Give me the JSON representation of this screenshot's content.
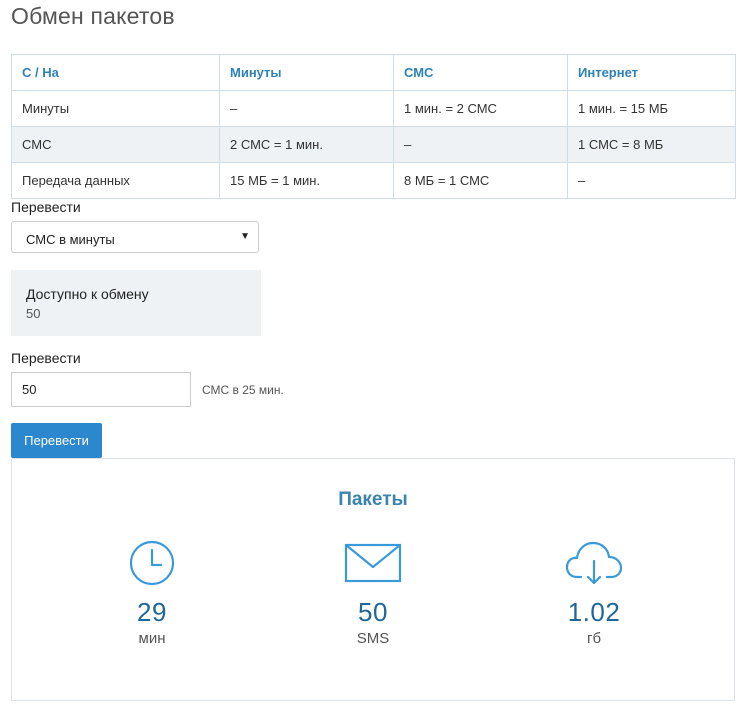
{
  "page": {
    "title": "Обмен пакетов"
  },
  "table": {
    "headers": [
      "С / На",
      "Минуты",
      "СМС",
      "Интернет"
    ],
    "rows": [
      [
        "Минуты",
        "–",
        "1 мин. = 2 СМС",
        "1 мин. = 15 МБ"
      ],
      [
        "СМС",
        "2 СМС = 1 мин.",
        "–",
        "1 СМС = 8 МБ"
      ],
      [
        "Передача данных",
        "15 МБ = 1 мин.",
        "8 МБ = 1 СМС",
        "–"
      ]
    ]
  },
  "convert": {
    "label": "Перевести",
    "selected_option": "СМС в минуты"
  },
  "available": {
    "title": "Доступно к обмену",
    "value": "50"
  },
  "amount": {
    "label": "Перевести",
    "value": "50",
    "hint": "СМС в 25 мин.",
    "button_label": "Перевести"
  },
  "packages": {
    "title": "Пакеты",
    "items": [
      {
        "icon": "clock-icon",
        "value": "29",
        "unit": "мин"
      },
      {
        "icon": "envelope-icon",
        "value": "50",
        "unit": "SMS"
      },
      {
        "icon": "cloud-download-icon",
        "value": "1.02",
        "unit": "гб"
      }
    ]
  },
  "colors": {
    "accent": "#2b88cf",
    "header_text": "#2e82b8",
    "icon": "#3a9ad9",
    "value": "#1f6797"
  }
}
